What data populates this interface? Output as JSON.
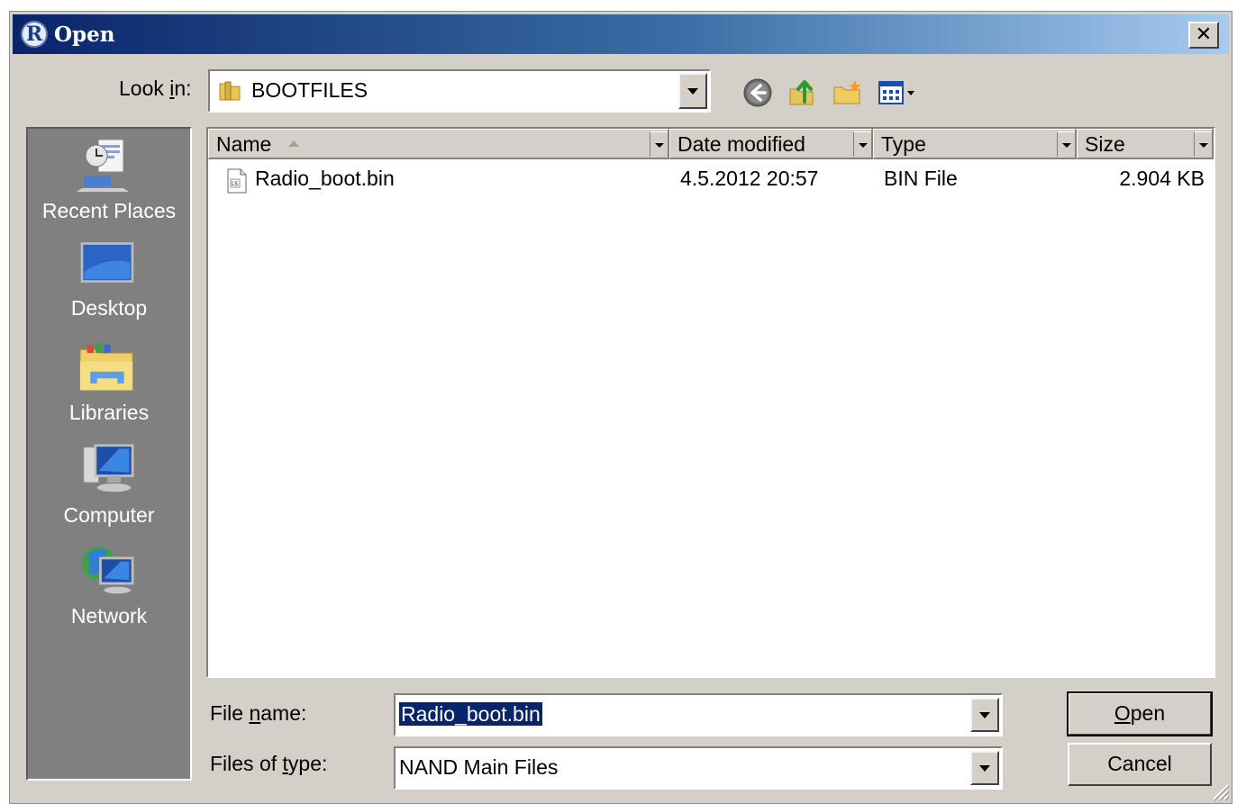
{
  "window": {
    "title": "Open",
    "logo_letter": "R",
    "close_glyph": "✕"
  },
  "lookin": {
    "label_pre": "Look ",
    "label_accel": "i",
    "label_post": "n:",
    "value": "BOOTFILES",
    "icon": "folder-icon"
  },
  "toolbar": {
    "icons": [
      "back-icon",
      "up-folder-icon",
      "new-folder-icon",
      "view-menu-icon"
    ]
  },
  "places": [
    {
      "label": "Recent Places",
      "icon": "recent-places-icon"
    },
    {
      "label": "Desktop",
      "icon": "desktop-icon"
    },
    {
      "label": "Libraries",
      "icon": "libraries-icon"
    },
    {
      "label": "Computer",
      "icon": "computer-icon"
    },
    {
      "label": "Network",
      "icon": "network-icon"
    }
  ],
  "filelist": {
    "columns": [
      "Name",
      "Date modified",
      "Type",
      "Size"
    ],
    "sorted_by": "Name",
    "rows": [
      {
        "name": "Radio_boot.bin",
        "date": "4.5.2012 20:57",
        "type": "BIN File",
        "size": "2.904 KB"
      }
    ]
  },
  "filename": {
    "label_pre": "File ",
    "label_accel": "n",
    "label_post": "ame:",
    "value": "Radio_boot.bin"
  },
  "filetype": {
    "label_pre": "Files of ",
    "label_accel": "t",
    "label_post": "ype:",
    "value": "NAND Main Files"
  },
  "buttons": {
    "open_accel": "O",
    "open_rest": "pen",
    "cancel": "Cancel"
  },
  "colors": {
    "title_gradient_start": "#0a246a",
    "title_gradient_end": "#a6caf0",
    "dialog_face": "#d4d0c8",
    "places_bg": "#808080",
    "selection": "#0a246a"
  }
}
